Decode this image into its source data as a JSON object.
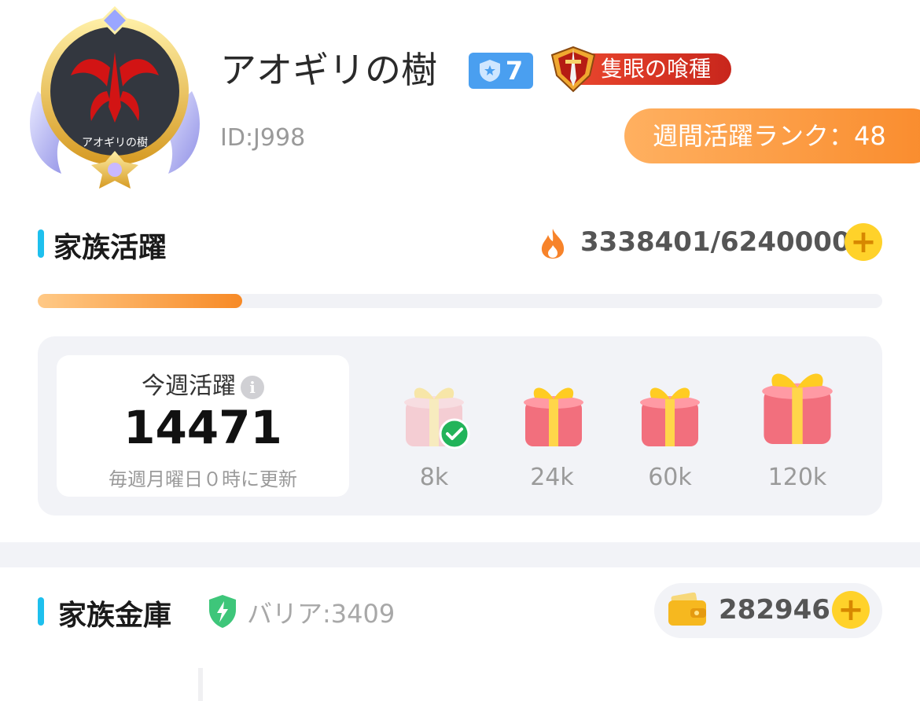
{
  "header": {
    "family_name": "アオギリの樹",
    "level": "7",
    "title_badge": "隻眼の喰種",
    "family_id": "ID:J998",
    "weekly_rank": "週間活躍ランク：48",
    "avatar_emblem_text": "アオギリの樹"
  },
  "activity": {
    "section_title": "家族活躍",
    "current_total": "3338401/6240000",
    "progress_fraction": 0.535,
    "progress_shown_fraction": 0.242,
    "plus_label": "+"
  },
  "weekly": {
    "label": "今週活躍",
    "info_label": "i",
    "value": "14471",
    "note": "毎週月曜日０時に更新",
    "rewards": [
      {
        "threshold": "8k",
        "claimed": true
      },
      {
        "threshold": "24k",
        "claimed": false
      },
      {
        "threshold": "60k",
        "claimed": false
      },
      {
        "threshold": "120k",
        "claimed": false
      }
    ]
  },
  "vault": {
    "section_title": "家族金庫",
    "barrier": "バリア:3409",
    "balance": "282946",
    "plus_label": "+"
  },
  "icons": {
    "fire": "fire-icon",
    "shield": "shield-lightning-icon",
    "wallet": "wallet-icon",
    "gift": "gift-box-icon",
    "check": "check-icon"
  },
  "colors": {
    "accent_blue": "#1ec0ee",
    "progress_orange": "#f78a26",
    "rank_pill": "#f98b2c",
    "title_badge_red": "#d9321f",
    "level_badge": "#4a9ff0",
    "claimed_green": "#22b45a"
  }
}
